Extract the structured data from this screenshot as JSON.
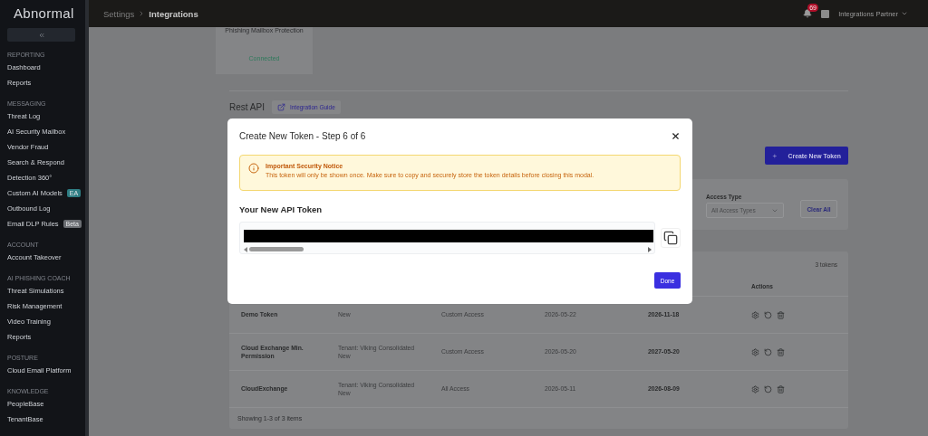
{
  "sidebar": {
    "logo": "Abnormal",
    "sections": [
      {
        "heading": "REPORTING",
        "items": [
          {
            "label": "Dashboard"
          },
          {
            "label": "Reports"
          }
        ]
      },
      {
        "heading": "MESSAGING",
        "items": [
          {
            "label": "Threat Log"
          },
          {
            "label": "AI Security Mailbox"
          },
          {
            "label": "Vendor Fraud"
          },
          {
            "label": "Search & Respond"
          },
          {
            "label": "Detection 360°"
          },
          {
            "label": "Custom AI Models",
            "badge": {
              "text": "EA",
              "color": "#2e7d83"
            }
          },
          {
            "label": "Outbound Log"
          },
          {
            "label": "Email DLP Rules",
            "badge": {
              "text": "Beta",
              "color": "#6b6e73"
            }
          }
        ]
      },
      {
        "heading": "ACCOUNT",
        "items": [
          {
            "label": "Account Takeover"
          }
        ]
      },
      {
        "heading": "AI PHISHING COACH",
        "items": [
          {
            "label": "Threat Simulations"
          },
          {
            "label": "Risk Management"
          },
          {
            "label": "Video Training"
          },
          {
            "label": "Reports"
          }
        ]
      },
      {
        "heading": "POSTURE",
        "items": [
          {
            "label": "Cloud Email Platform"
          }
        ]
      },
      {
        "heading": "KNOWLEDGE",
        "items": [
          {
            "label": "PeopleBase"
          },
          {
            "label": "TenantBase"
          }
        ]
      }
    ]
  },
  "header": {
    "breadcrumb": [
      "Settings",
      "Integrations"
    ],
    "notifications": "69",
    "user": "Integrations Partner"
  },
  "integration_card": {
    "name": "Phishing Mailbox Protection",
    "status": "Connected"
  },
  "rest_api": {
    "title": "Rest API",
    "guide_link": "Integration Guide",
    "create_button": "Create New Token"
  },
  "filters": {
    "access_type": {
      "label": "Access Type",
      "value": "All Access Types"
    },
    "clear_button": "Clear All"
  },
  "table": {
    "count": "3 tokens",
    "columns": [
      {
        "label": "Actions"
      }
    ],
    "rows": [
      {
        "name": "Demo Token",
        "tenant": [
          "New"
        ],
        "access": "Custom Access",
        "created": "2026-05-22",
        "expires": "2026-11-18"
      },
      {
        "name": "Cloud Exchange Min. Permission",
        "tenant": [
          "Tenant: Viking Consolidated",
          "New"
        ],
        "access": "Custom Access",
        "created": "2026-05-20",
        "expires": "2027-05-20"
      },
      {
        "name": "CloudExchange",
        "tenant": [
          "Tenant: Viking Consolidated",
          "New"
        ],
        "access": "All Access",
        "created": "2026-05-11",
        "expires": "2026-08-09"
      }
    ],
    "footer": "Showing 1-3 of 3 items"
  },
  "modal": {
    "title": "Create New Token - Step 6 of 6",
    "notice": {
      "title": "Important Security Notice",
      "text": "This token will only be shown once. Make sure to copy and securely store the token details before closing this modal."
    },
    "token_label": "Your New API Token",
    "done_button": "Done"
  }
}
